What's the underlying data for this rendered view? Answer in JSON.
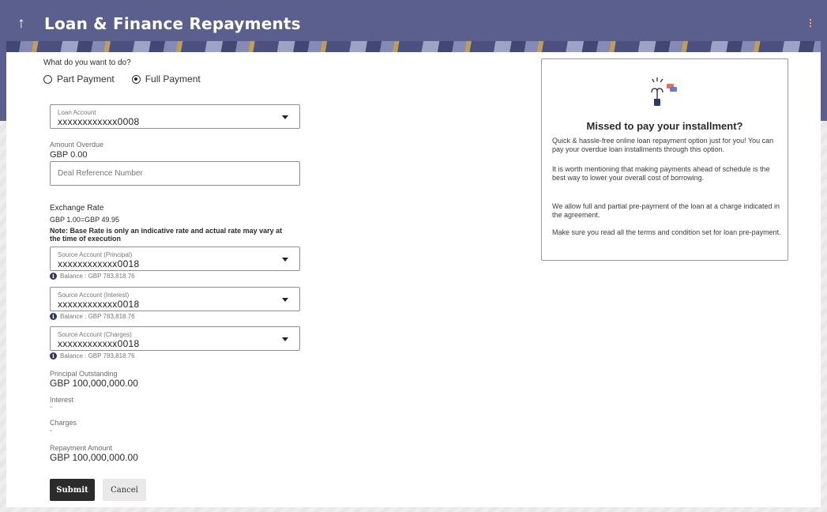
{
  "header": {
    "title": "Loan & Finance Repayments",
    "back_icon": "arrow-up-icon",
    "menu_icon": "kebab-icon",
    "color": "#5b5f8e"
  },
  "form": {
    "question": "What do you want to do?",
    "options": [
      {
        "label": "Part Payment",
        "selected": false
      },
      {
        "label": "Full Payment",
        "selected": true
      }
    ],
    "loan_account": {
      "label": "Loan Account",
      "value": "xxxxxxxxxxxx0008"
    },
    "amount_overdue": {
      "label": "Amount Overdue",
      "value": "GBP 0.00"
    },
    "deal_reference": {
      "placeholder": "Deal Reference Number",
      "value": ""
    },
    "exchange_rate": {
      "label": "Exchange Rate",
      "value": "GBP 1.00=GBP 49.95",
      "note": "Note: Base Rate is only an indicative rate and actual rate may vary at the time of execution"
    },
    "source_accounts": [
      {
        "label": "Source Account (Principal)",
        "value": "xxxxxxxxxxxx0018",
        "balance": "Balance : GBP 783,818.76"
      },
      {
        "label": "Source Account (Interest)",
        "value": "xxxxxxxxxxxx0018",
        "balance": "Balance : GBP 783,818.76"
      },
      {
        "label": "Source Account (Charges)",
        "value": "xxxxxxxxxxxx0018",
        "balance": "Balance : GBP 783,818.76"
      }
    ],
    "principal_outstanding": {
      "label": "Principal Outstanding",
      "value": "GBP 100,000,000.00"
    },
    "interest": {
      "label": "Interest",
      "value": "-"
    },
    "charges": {
      "label": "Charges",
      "value": "-"
    },
    "repayment_amount": {
      "label": "Repayment Amount",
      "value": "GBP 100,000,000.00"
    },
    "submit_label": "Submit",
    "cancel_label": "Cancel"
  },
  "info_card": {
    "icon": "lamp-idea-icon",
    "title": "Missed to pay your installment?",
    "paragraphs": [
      "Quick & hassle-free online loan repayment option just for you! You can pay your overdue loan installments through this option.",
      "It is worth mentioning that making payments ahead of schedule is the best way to lower your overall cost of borrowing.",
      "We allow full and partial pre-payment of the loan at a charge indicated in the agreement.",
      "Make sure you read all the terms and condition set for loan pre-payment."
    ]
  }
}
